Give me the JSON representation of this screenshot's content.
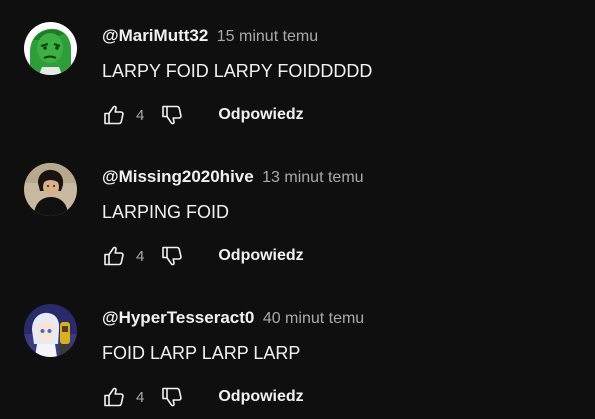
{
  "comments": [
    {
      "author": "@MariMutt32",
      "time": "15 minut temu",
      "text": "LARPY FOID LARPY FOIDDDDD",
      "likes": "4",
      "reply_label": "Odpowiedz",
      "avatar_icon": "green-wojak-avatar"
    },
    {
      "author": "@Missing2020hive",
      "time": "13 minut temu",
      "text": "LARPING FOID",
      "likes": "4",
      "reply_label": "Odpowiedz",
      "avatar_icon": "person-photo-avatar"
    },
    {
      "author": "@HyperTesseract0",
      "time": "40 minut temu",
      "text": "FOID LARP LARP LARP",
      "likes": "4",
      "reply_label": "Odpowiedz",
      "avatar_icon": "anime-character-avatar"
    }
  ],
  "icons": {
    "like": "thumbs-up-icon",
    "dislike": "thumbs-down-icon"
  },
  "colors": {
    "background": "#0f0f0f",
    "primary_text": "#f1f1f1",
    "secondary_text": "#aaaaaa"
  }
}
